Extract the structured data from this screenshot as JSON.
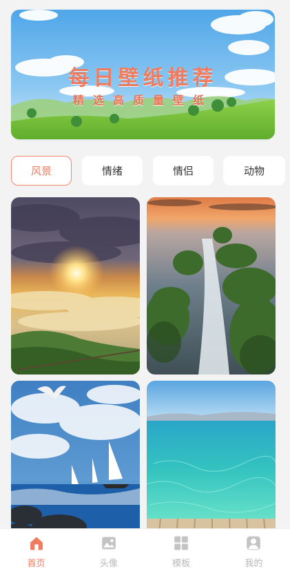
{
  "banner": {
    "title": "每日壁纸推荐",
    "subtitle": "精选高质量壁纸"
  },
  "categories": [
    {
      "label": "风景",
      "active": true
    },
    {
      "label": "情绪",
      "active": false
    },
    {
      "label": "情侣",
      "active": false
    },
    {
      "label": "动物",
      "active": false
    }
  ],
  "wallpapers": [
    {
      "subject": "sunset-over-clouds"
    },
    {
      "subject": "rocky-coast-stream"
    },
    {
      "subject": "sailboats-and-seagull"
    },
    {
      "subject": "turquoise-sea-pier"
    }
  ],
  "bottom_nav": [
    {
      "label": "首页",
      "icon": "home-icon",
      "active": true
    },
    {
      "label": "头像",
      "icon": "image-icon",
      "active": false
    },
    {
      "label": "模板",
      "icon": "grid-icon",
      "active": false
    },
    {
      "label": "我的",
      "icon": "user-icon",
      "active": false
    }
  ],
  "colors": {
    "accent": "#f07b5e",
    "background": "#f3f3f3",
    "inactive": "#b8b8b8"
  }
}
